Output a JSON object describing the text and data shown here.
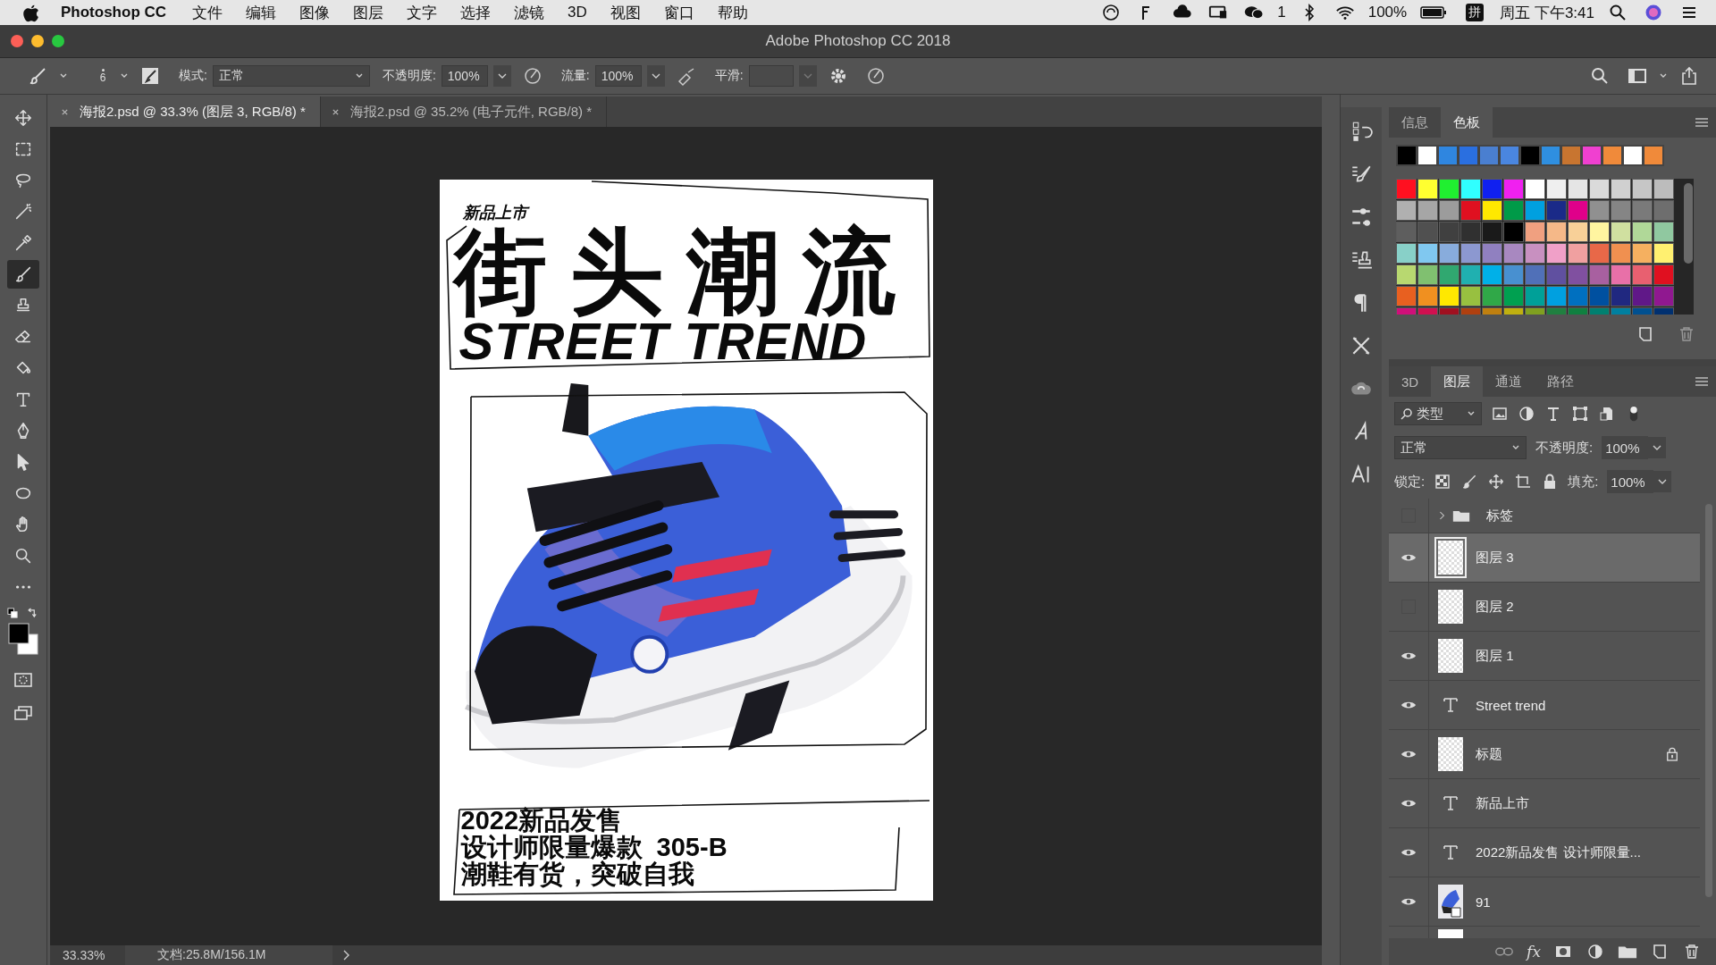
{
  "menu_bar": {
    "app_name": "Photoshop CC",
    "menus": [
      "文件",
      "编辑",
      "图像",
      "图层",
      "文字",
      "选择",
      "滤镜",
      "3D",
      "视图",
      "窗口",
      "帮助"
    ],
    "wechat_count": "1",
    "battery": "100%",
    "input_method": "拼",
    "clock": "周五 下午3:41"
  },
  "window": {
    "title": "Adobe Photoshop CC 2018"
  },
  "options_bar": {
    "brush_size": "6",
    "mode_label": "模式:",
    "mode": "正常",
    "opacity_label": "不透明度:",
    "opacity": "100%",
    "flow_label": "流量:",
    "flow": "100%",
    "smoothing_label": "平滑:"
  },
  "document_tabs": [
    {
      "title": "海报2.psd @ 33.3% (图层 3, RGB/8) *",
      "selected": true
    },
    {
      "title": "海报2.psd @ 35.2% (电子元件, RGB/8) *",
      "selected": false
    }
  ],
  "tools": [
    {
      "kind": "move",
      "selected": false
    },
    {
      "kind": "marquee",
      "selected": false
    },
    {
      "kind": "lasso",
      "selected": false
    },
    {
      "kind": "wand",
      "selected": false
    },
    {
      "kind": "eyedropper",
      "selected": false
    },
    {
      "kind": "brush",
      "selected": true
    },
    {
      "kind": "stamp",
      "selected": false
    },
    {
      "kind": "eraser",
      "selected": false
    },
    {
      "kind": "bucket",
      "selected": false
    },
    {
      "kind": "type",
      "selected": false
    },
    {
      "kind": "pen",
      "selected": false
    },
    {
      "kind": "arrow",
      "selected": false
    },
    {
      "kind": "ellipse",
      "selected": false
    },
    {
      "kind": "hand",
      "selected": false
    },
    {
      "kind": "zoom",
      "selected": false
    },
    {
      "kind": "more",
      "selected": false
    }
  ],
  "poster": {
    "tag": "新品上市",
    "headline": "街头潮流",
    "subtitle": "STREET TREND",
    "lines": [
      "2022新品发售",
      "设计师限量爆款  305-B",
      "潮鞋有货，突破自我"
    ]
  },
  "status_bar": {
    "zoom": "33.33%",
    "doc_info": "文档:25.8M/156.1M"
  },
  "swatches_panel": {
    "tabs": [
      {
        "label": "信息",
        "selected": false
      },
      {
        "label": "色板",
        "selected": true
      }
    ],
    "recent": [
      {
        "color": "#000000"
      },
      {
        "color": "#ffffff"
      },
      {
        "color": "#2f86e0"
      },
      {
        "color": "#2a6fe0"
      },
      {
        "color": "#4a7fd0"
      },
      {
        "color": "#4a86e0"
      },
      {
        "color": "#000000"
      },
      {
        "color": "#2f8fe0"
      },
      {
        "color": "#c87530"
      },
      {
        "color": "#f040d0"
      },
      {
        "color": "#f08a3a"
      },
      {
        "color": "#ffffff"
      },
      {
        "color": "#f08a3a"
      }
    ],
    "grid": [
      {
        "color": "#ff1020"
      },
      {
        "color": "#ffff30"
      },
      {
        "color": "#20f030"
      },
      {
        "color": "#30ffff"
      },
      {
        "color": "#1020f0"
      },
      {
        "color": "#f020f0"
      },
      {
        "color": "#ffffff"
      },
      {
        "color": "#efefef"
      },
      {
        "color": "#e5e5e5"
      },
      {
        "color": "#dadada"
      },
      {
        "color": "#d0d0d0"
      },
      {
        "color": "#c6c6c6"
      },
      {
        "color": "#bcbcbc"
      },
      {
        "color": "#b0b0b0"
      },
      {
        "color": "#a6a6a6"
      },
      {
        "color": "#9c9c9c"
      },
      {
        "color": "#e01020"
      },
      {
        "color": "#ffe800"
      },
      {
        "color": "#009a48"
      },
      {
        "color": "#00a0e0"
      },
      {
        "color": "#1a2a88"
      },
      {
        "color": "#e0008a"
      },
      {
        "color": "#909090"
      },
      {
        "color": "#858585"
      },
      {
        "color": "#7a7a7a"
      },
      {
        "color": "#6e6e6e"
      },
      {
        "color": "#5e5e5e"
      },
      {
        "color": "#505050"
      },
      {
        "color": "#404040"
      },
      {
        "color": "#303030"
      },
      {
        "color": "#1a1a1a"
      },
      {
        "color": "#000000"
      },
      {
        "color": "#f0a080"
      },
      {
        "color": "#f5b888"
      },
      {
        "color": "#f8d098"
      },
      {
        "color": "#fff5a0"
      },
      {
        "color": "#d0e0a0"
      },
      {
        "color": "#b0d898"
      },
      {
        "color": "#90c8a0"
      },
      {
        "color": "#88d0c8"
      },
      {
        "color": "#80c8f0"
      },
      {
        "color": "#88acdc"
      },
      {
        "color": "#8c98d0"
      },
      {
        "color": "#9080c0"
      },
      {
        "color": "#a888c0"
      },
      {
        "color": "#c890c0"
      },
      {
        "color": "#f0a0c8"
      },
      {
        "color": "#f0a0a0"
      },
      {
        "color": "#e86848"
      },
      {
        "color": "#f09050"
      },
      {
        "color": "#f5b060"
      },
      {
        "color": "#fff070"
      },
      {
        "color": "#b8d870"
      },
      {
        "color": "#80c070"
      },
      {
        "color": "#30a870"
      },
      {
        "color": "#20b0b0"
      },
      {
        "color": "#00b0e8"
      },
      {
        "color": "#4890d0"
      },
      {
        "color": "#5070b8"
      },
      {
        "color": "#6050a0"
      },
      {
        "color": "#8050a0"
      },
      {
        "color": "#a860a0"
      },
      {
        "color": "#e870a8"
      },
      {
        "color": "#e86070"
      },
      {
        "color": "#e01020"
      },
      {
        "color": "#e86020"
      },
      {
        "color": "#f09020"
      },
      {
        "color": "#ffe800"
      },
      {
        "color": "#98c040"
      },
      {
        "color": "#30a848"
      },
      {
        "color": "#00a050"
      },
      {
        "color": "#00a098"
      },
      {
        "color": "#00a0e0"
      },
      {
        "color": "#0070c0"
      },
      {
        "color": "#0050a0"
      },
      {
        "color": "#202880"
      },
      {
        "color": "#601888"
      },
      {
        "color": "#901890"
      },
      {
        "color": "#d0107a"
      },
      {
        "color": "#d01050"
      },
      {
        "color": "#a01020"
      },
      {
        "color": "#b04010"
      },
      {
        "color": "#c08010"
      },
      {
        "color": "#c0b010"
      },
      {
        "color": "#80a020"
      },
      {
        "color": "#208040"
      },
      {
        "color": "#108040"
      },
      {
        "color": "#008070"
      },
      {
        "color": "#0080a0"
      },
      {
        "color": "#005090"
      },
      {
        "color": "#003070"
      }
    ]
  },
  "layers_panel": {
    "tabs": [
      {
        "label": "3D",
        "selected": false
      },
      {
        "label": "图层",
        "selected": true
      },
      {
        "label": "通道",
        "selected": false
      },
      {
        "label": "路径",
        "selected": false
      }
    ],
    "filter": "类型",
    "blend_mode": "正常",
    "opacity_label": "不透明度:",
    "opacity": "100%",
    "lock_label": "锁定:",
    "fill_label": "填充:",
    "fill": "100%",
    "fx_label": "fx",
    "layers": [
      {
        "name": "标签",
        "kind": "group",
        "visible": false,
        "expanded": false,
        "selected": false,
        "locked": false
      },
      {
        "name": "图层 3",
        "kind": "pixel",
        "visible": true,
        "selected": true,
        "locked": false
      },
      {
        "name": "图层 2",
        "kind": "pixel",
        "visible": false,
        "selected": false,
        "locked": false
      },
      {
        "name": "图层 1",
        "kind": "pixel",
        "visible": true,
        "selected": false,
        "locked": false
      },
      {
        "name": "Street trend",
        "kind": "text",
        "visible": true,
        "selected": false,
        "locked": false
      },
      {
        "name": "标题",
        "kind": "pixel",
        "visible": true,
        "selected": false,
        "locked": true
      },
      {
        "name": "新品上市",
        "kind": "text",
        "visible": true,
        "selected": false,
        "locked": false
      },
      {
        "name": "2022新品发售 设计师限量...",
        "kind": "text",
        "visible": true,
        "selected": false,
        "locked": false
      },
      {
        "name": "91",
        "kind": "smart",
        "visible": true,
        "selected": false,
        "locked": false
      },
      {
        "kind": "fill",
        "selected": false
      }
    ]
  }
}
